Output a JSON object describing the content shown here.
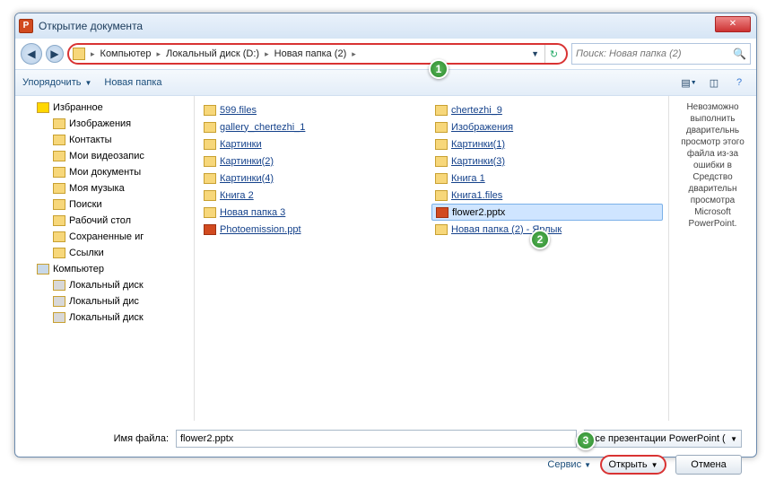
{
  "title": "Открытие документа",
  "breadcrumb": [
    "Компьютер",
    "Локальный диск (D:)",
    "Новая папка (2)"
  ],
  "search_placeholder": "Поиск: Новая папка (2)",
  "toolbar": {
    "organize": "Упорядочить",
    "newfolder": "Новая папка"
  },
  "tree": {
    "items": [
      {
        "label": "Избранное",
        "cls": "star",
        "lvl": 1
      },
      {
        "label": "Изображения",
        "lvl": 2
      },
      {
        "label": "Контакты",
        "lvl": 2
      },
      {
        "label": "Мои видеозапис",
        "lvl": 2
      },
      {
        "label": "Мои документы",
        "lvl": 2
      },
      {
        "label": "Моя музыка",
        "lvl": 2
      },
      {
        "label": "Поиски",
        "lvl": 2
      },
      {
        "label": "Рабочий стол",
        "lvl": 2
      },
      {
        "label": "Сохраненные иг",
        "lvl": 2
      },
      {
        "label": "Ссылки",
        "lvl": 2
      },
      {
        "label": "Компьютер",
        "cls": "comp",
        "lvl": 1
      },
      {
        "label": "Локальный диск",
        "cls": "drive",
        "lvl": 2
      },
      {
        "label": "Локальный дис",
        "cls": "drive",
        "lvl": 2
      },
      {
        "label": "Локальный диск",
        "cls": "drive",
        "lvl": 2
      }
    ]
  },
  "files": {
    "col1": [
      {
        "name": "599.files",
        "type": "folder"
      },
      {
        "name": "gallery_chertezhi_1",
        "type": "folder"
      },
      {
        "name": "Картинки",
        "type": "folder"
      },
      {
        "name": "Картинки(2)",
        "type": "folder"
      },
      {
        "name": "Картинки(4)",
        "type": "folder"
      },
      {
        "name": "Книга 2",
        "type": "folder"
      },
      {
        "name": "Новая папка 3",
        "type": "folder"
      },
      {
        "name": "Photoemission.ppt",
        "type": "ppt"
      }
    ],
    "col2": [
      {
        "name": "chertezhi_9",
        "type": "folder"
      },
      {
        "name": "Изображения",
        "type": "folder"
      },
      {
        "name": "Картинки(1)",
        "type": "folder"
      },
      {
        "name": "Картинки(3)",
        "type": "folder"
      },
      {
        "name": "Книга 1",
        "type": "folder"
      },
      {
        "name": "Книга1.files",
        "type": "folder"
      },
      {
        "name": "flower2.pptx",
        "type": "ppt",
        "selected": true
      },
      {
        "name": "Новая папка (2) - Ярлык",
        "type": "shortcut"
      }
    ]
  },
  "preview_text": "Невозможно выполнить дварительнь просмотр этого файла из-за ошибки в Средство дварительн просмотра Microsoft PowerPoint.",
  "footer": {
    "filename_label": "Имя файла:",
    "filename_value": "flower2.pptx",
    "filetype": "Все презентации PowerPoint (",
    "service": "Сервис",
    "open": "Открыть",
    "cancel": "Отмена"
  },
  "badges": {
    "b1": "1",
    "b2": "2",
    "b3": "3"
  }
}
